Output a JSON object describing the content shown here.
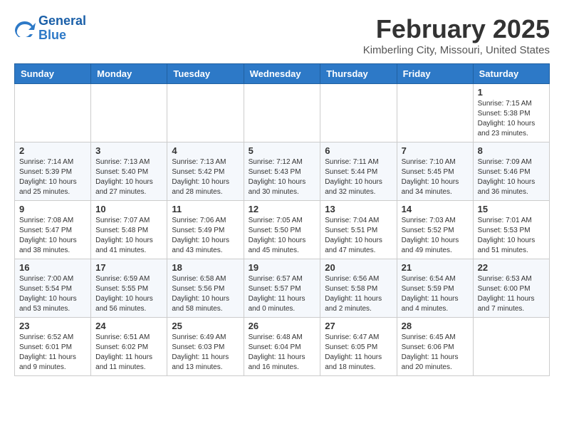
{
  "header": {
    "logo_line1": "General",
    "logo_line2": "Blue",
    "title": "February 2025",
    "subtitle": "Kimberling City, Missouri, United States"
  },
  "weekdays": [
    "Sunday",
    "Monday",
    "Tuesday",
    "Wednesday",
    "Thursday",
    "Friday",
    "Saturday"
  ],
  "weeks": [
    [
      {
        "day": "",
        "info": ""
      },
      {
        "day": "",
        "info": ""
      },
      {
        "day": "",
        "info": ""
      },
      {
        "day": "",
        "info": ""
      },
      {
        "day": "",
        "info": ""
      },
      {
        "day": "",
        "info": ""
      },
      {
        "day": "1",
        "info": "Sunrise: 7:15 AM\nSunset: 5:38 PM\nDaylight: 10 hours and 23 minutes."
      }
    ],
    [
      {
        "day": "2",
        "info": "Sunrise: 7:14 AM\nSunset: 5:39 PM\nDaylight: 10 hours and 25 minutes."
      },
      {
        "day": "3",
        "info": "Sunrise: 7:13 AM\nSunset: 5:40 PM\nDaylight: 10 hours and 27 minutes."
      },
      {
        "day": "4",
        "info": "Sunrise: 7:13 AM\nSunset: 5:42 PM\nDaylight: 10 hours and 28 minutes."
      },
      {
        "day": "5",
        "info": "Sunrise: 7:12 AM\nSunset: 5:43 PM\nDaylight: 10 hours and 30 minutes."
      },
      {
        "day": "6",
        "info": "Sunrise: 7:11 AM\nSunset: 5:44 PM\nDaylight: 10 hours and 32 minutes."
      },
      {
        "day": "7",
        "info": "Sunrise: 7:10 AM\nSunset: 5:45 PM\nDaylight: 10 hours and 34 minutes."
      },
      {
        "day": "8",
        "info": "Sunrise: 7:09 AM\nSunset: 5:46 PM\nDaylight: 10 hours and 36 minutes."
      }
    ],
    [
      {
        "day": "9",
        "info": "Sunrise: 7:08 AM\nSunset: 5:47 PM\nDaylight: 10 hours and 38 minutes."
      },
      {
        "day": "10",
        "info": "Sunrise: 7:07 AM\nSunset: 5:48 PM\nDaylight: 10 hours and 41 minutes."
      },
      {
        "day": "11",
        "info": "Sunrise: 7:06 AM\nSunset: 5:49 PM\nDaylight: 10 hours and 43 minutes."
      },
      {
        "day": "12",
        "info": "Sunrise: 7:05 AM\nSunset: 5:50 PM\nDaylight: 10 hours and 45 minutes."
      },
      {
        "day": "13",
        "info": "Sunrise: 7:04 AM\nSunset: 5:51 PM\nDaylight: 10 hours and 47 minutes."
      },
      {
        "day": "14",
        "info": "Sunrise: 7:03 AM\nSunset: 5:52 PM\nDaylight: 10 hours and 49 minutes."
      },
      {
        "day": "15",
        "info": "Sunrise: 7:01 AM\nSunset: 5:53 PM\nDaylight: 10 hours and 51 minutes."
      }
    ],
    [
      {
        "day": "16",
        "info": "Sunrise: 7:00 AM\nSunset: 5:54 PM\nDaylight: 10 hours and 53 minutes."
      },
      {
        "day": "17",
        "info": "Sunrise: 6:59 AM\nSunset: 5:55 PM\nDaylight: 10 hours and 56 minutes."
      },
      {
        "day": "18",
        "info": "Sunrise: 6:58 AM\nSunset: 5:56 PM\nDaylight: 10 hours and 58 minutes."
      },
      {
        "day": "19",
        "info": "Sunrise: 6:57 AM\nSunset: 5:57 PM\nDaylight: 11 hours and 0 minutes."
      },
      {
        "day": "20",
        "info": "Sunrise: 6:56 AM\nSunset: 5:58 PM\nDaylight: 11 hours and 2 minutes."
      },
      {
        "day": "21",
        "info": "Sunrise: 6:54 AM\nSunset: 5:59 PM\nDaylight: 11 hours and 4 minutes."
      },
      {
        "day": "22",
        "info": "Sunrise: 6:53 AM\nSunset: 6:00 PM\nDaylight: 11 hours and 7 minutes."
      }
    ],
    [
      {
        "day": "23",
        "info": "Sunrise: 6:52 AM\nSunset: 6:01 PM\nDaylight: 11 hours and 9 minutes."
      },
      {
        "day": "24",
        "info": "Sunrise: 6:51 AM\nSunset: 6:02 PM\nDaylight: 11 hours and 11 minutes."
      },
      {
        "day": "25",
        "info": "Sunrise: 6:49 AM\nSunset: 6:03 PM\nDaylight: 11 hours and 13 minutes."
      },
      {
        "day": "26",
        "info": "Sunrise: 6:48 AM\nSunset: 6:04 PM\nDaylight: 11 hours and 16 minutes."
      },
      {
        "day": "27",
        "info": "Sunrise: 6:47 AM\nSunset: 6:05 PM\nDaylight: 11 hours and 18 minutes."
      },
      {
        "day": "28",
        "info": "Sunrise: 6:45 AM\nSunset: 6:06 PM\nDaylight: 11 hours and 20 minutes."
      },
      {
        "day": "",
        "info": ""
      }
    ]
  ]
}
